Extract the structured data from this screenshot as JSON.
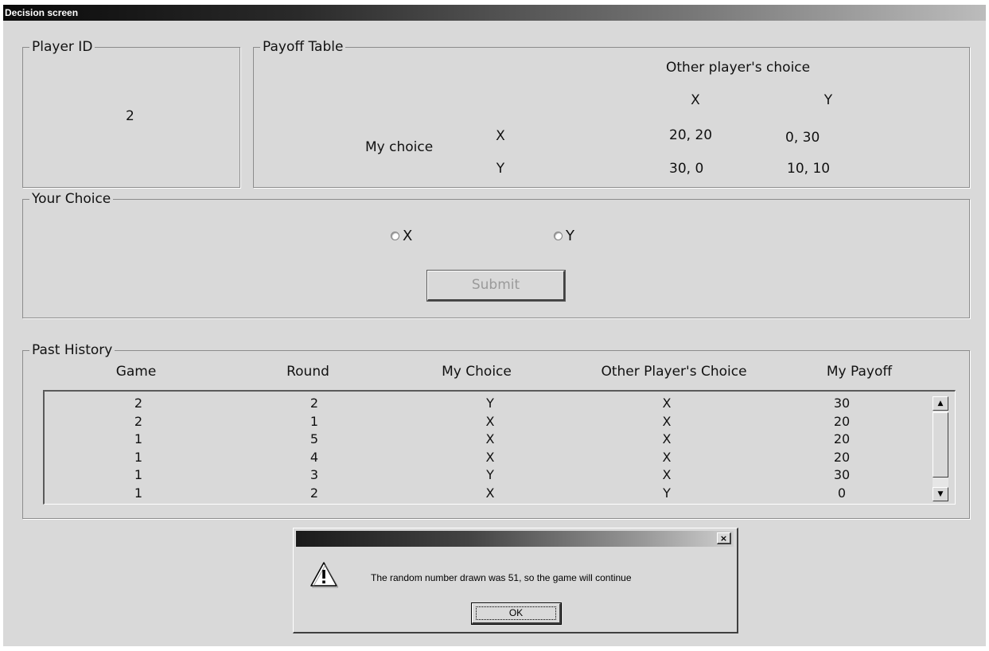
{
  "window": {
    "title": "Decision screen"
  },
  "player_id": {
    "legend": "Player ID",
    "value": "2"
  },
  "payoff_table": {
    "legend": "Payoff Table",
    "other_header": "Other player's choice",
    "col_x": "X",
    "col_y": "Y",
    "my_choice_label": "My choice",
    "row_x": "X",
    "row_y": "Y",
    "xx": "20, 20",
    "xy": "0, 30",
    "yx": "30, 0",
    "yy": "10, 10"
  },
  "your_choice": {
    "legend": "Your Choice",
    "option_x": "X",
    "option_y": "Y",
    "submit_label": "Submit",
    "submit_enabled": false
  },
  "past_history": {
    "legend": "Past History",
    "headers": [
      "Game",
      "Round",
      "My Choice",
      "Other Player's Choice",
      "My Payoff"
    ],
    "rows": [
      [
        "2",
        "2",
        "Y",
        "X",
        "30"
      ],
      [
        "2",
        "1",
        "X",
        "X",
        "20"
      ],
      [
        "1",
        "5",
        "X",
        "X",
        "20"
      ],
      [
        "1",
        "4",
        "X",
        "X",
        "20"
      ],
      [
        "1",
        "3",
        "Y",
        "X",
        "30"
      ],
      [
        "1",
        "2",
        "X",
        "Y",
        "0"
      ]
    ]
  },
  "dialog": {
    "icon": "warning-icon",
    "message": "The random number drawn was 51, so the game will continue",
    "ok_label": "OK",
    "close_glyph": "×"
  },
  "scrollbar": {
    "up_glyph": "▲",
    "down_glyph": "▼"
  }
}
